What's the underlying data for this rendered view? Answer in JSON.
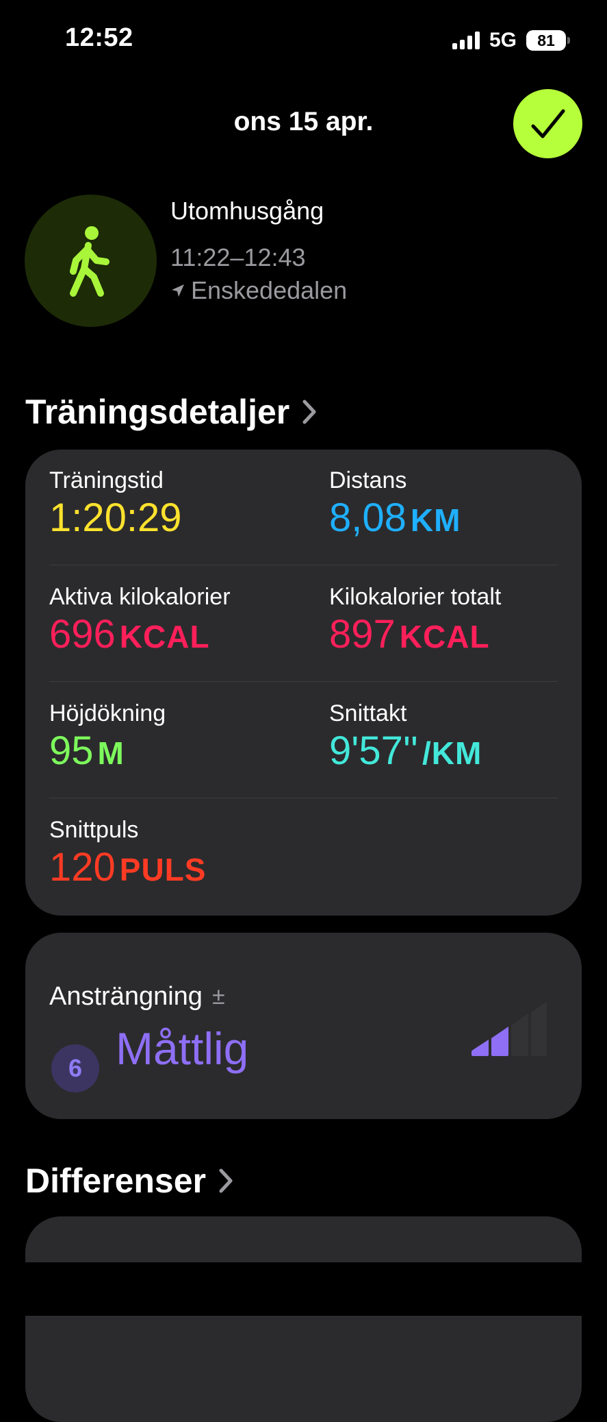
{
  "status_bar": {
    "time": "12:52",
    "network": "5G",
    "battery": "81"
  },
  "header": {
    "date": "ons 15 apr."
  },
  "workout": {
    "name": "Utomhusgång",
    "time_range": "11:22–12:43",
    "location": "Enskededalen"
  },
  "details": {
    "title": "Träningsdetaljer",
    "metrics": [
      {
        "label": "Träningstid",
        "value": "1:20:29",
        "unit": "",
        "color": "#ffe22d"
      },
      {
        "label": "Distans",
        "value": "8,08",
        "unit": "KM",
        "color": "#1fb0ff"
      },
      {
        "label": "Aktiva kilokalorier",
        "value": "696",
        "unit": "KCAL",
        "color": "#ff1f5a"
      },
      {
        "label": "Kilokalorier totalt",
        "value": "897",
        "unit": "KCAL",
        "color": "#ff1f5a"
      },
      {
        "label": "Höjdökning",
        "value": "95",
        "unit": "M",
        "color": "#7dfa5c"
      },
      {
        "label": "Snittakt",
        "value": "9'57''",
        "unit": "/KM",
        "color": "#43e8da"
      },
      {
        "label": "Snittpuls",
        "value": "120",
        "unit": "PULS",
        "color": "#ff3b24"
      }
    ]
  },
  "effort": {
    "label": "Ansträngning",
    "adjust_symbol": "±",
    "score": "6",
    "level": "Måttlig",
    "level_fraction": 0.5,
    "color": "#8e6ff5"
  },
  "differences": {
    "title": "Differenser"
  },
  "icons": {
    "done": "checkmark-icon",
    "workout": "walking-figure-icon",
    "location": "location-arrow-icon",
    "chevron": "chevron-right-icon"
  },
  "colors": {
    "accent": "#b6ff3b",
    "card_bg": "#2b2b2d",
    "secondary_text": "#9a9a9f"
  }
}
